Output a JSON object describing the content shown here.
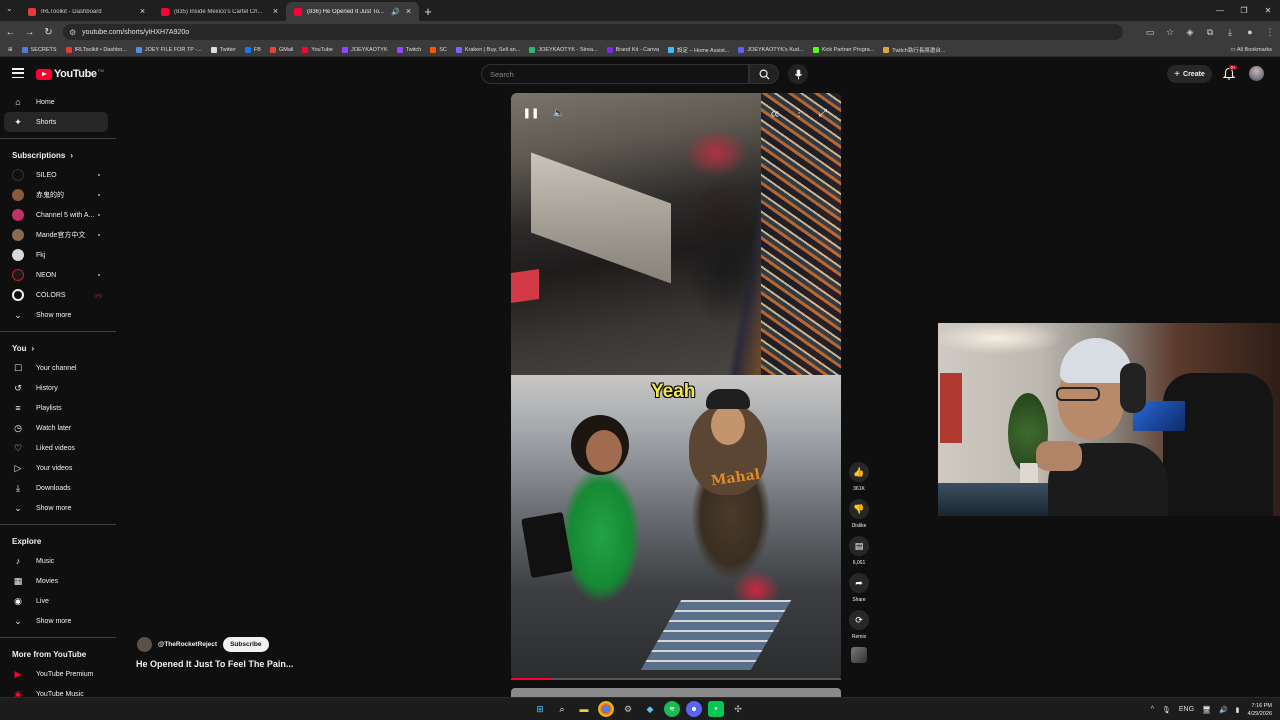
{
  "browser": {
    "tabs": [
      {
        "title": "IRLToolkit - Dashboard",
        "icon": "irltoolkit-icon",
        "active": false
      },
      {
        "title": "(835) Inside Mexico's Cartel Ch...",
        "icon": "youtube-icon",
        "active": false
      },
      {
        "title": "(836) He Opened It Just To...",
        "icon": "youtube-icon",
        "active": true
      }
    ],
    "url": "youtube.com/shorts/yiHXH7A920o",
    "bookmarks": [
      {
        "label": "SECRETS",
        "color": "#4f7bd8"
      },
      {
        "label": "IRLToolkit • Dashbo...",
        "color": "#e23b3b"
      },
      {
        "label": "JOEY FILE FOR TP -...",
        "color": "#4f8ee8"
      },
      {
        "label": "Twitter",
        "color": "#dddddd"
      },
      {
        "label": "FB",
        "color": "#1877f2"
      },
      {
        "label": "GMail",
        "color": "#ea4335"
      },
      {
        "label": "YouTube",
        "color": "#ff0033"
      },
      {
        "label": "JOEYKAOTYK",
        "color": "#9146ff"
      },
      {
        "label": "Twitch",
        "color": "#9146ff"
      },
      {
        "label": "SC",
        "color": "#ff5500"
      },
      {
        "label": "Kraken | Buy, Sell an...",
        "color": "#7b61ff"
      },
      {
        "label": "JOEYKAOTYK - Strea...",
        "color": "#2bb673"
      },
      {
        "label": "Brand Kit - Canva",
        "color": "#7d2ae8"
      },
      {
        "label": "設定 – Home Assist...",
        "color": "#41bdf5"
      },
      {
        "label": "JOEYKAOTYK's Kud...",
        "color": "#5865f2"
      },
      {
        "label": "Kick Partner Progra...",
        "color": "#53fc18"
      },
      {
        "label": "Twitch執行長將邀台...",
        "color": "#d9a441"
      }
    ],
    "all_bookmarks": "All Bookmarks"
  },
  "masthead": {
    "logo": "YouTube",
    "logo_suffix": "TW",
    "search_placeholder": "Search",
    "create_label": "Create",
    "notif_count": "9+"
  },
  "sidebar": {
    "main": [
      {
        "label": "Home",
        "icon": "home-icon",
        "glyph": "⌂"
      },
      {
        "label": "Shorts",
        "icon": "shorts-icon",
        "glyph": "✦"
      }
    ],
    "subscriptions_title": "Subscriptions",
    "subscriptions": [
      {
        "label": "SILEO",
        "color": "#111111",
        "badge": "dot"
      },
      {
        "label": "赤鬼的的",
        "color": "#8b5a3c",
        "badge": "dot"
      },
      {
        "label": "Channel 5 with A...",
        "color": "#c0306a",
        "badge": "dot"
      },
      {
        "label": "Mande官方中文",
        "color": "#8a6a50",
        "badge": "dot"
      },
      {
        "label": "Fkj",
        "color": "#d8d8d8",
        "badge": ""
      },
      {
        "label": "NEON",
        "color": "#cc1a2a",
        "badge": "dot"
      },
      {
        "label": "COLORS",
        "color": "#f4f4f4",
        "badge": "live"
      }
    ],
    "show_more": "Show more",
    "you_title": "You",
    "you": [
      {
        "label": "Your channel",
        "icon": "channel-icon",
        "glyph": "☐"
      },
      {
        "label": "History",
        "icon": "history-icon",
        "glyph": "↺"
      },
      {
        "label": "Playlists",
        "icon": "playlists-icon",
        "glyph": "≡"
      },
      {
        "label": "Watch later",
        "icon": "clock-icon",
        "glyph": "◷"
      },
      {
        "label": "Liked videos",
        "icon": "like-icon",
        "glyph": "♡"
      },
      {
        "label": "Your videos",
        "icon": "your-videos-icon",
        "glyph": "▷"
      },
      {
        "label": "Downloads",
        "icon": "download-icon",
        "glyph": "⤓"
      }
    ],
    "explore_title": "Explore",
    "explore": [
      {
        "label": "Music",
        "icon": "music-icon",
        "glyph": "♪"
      },
      {
        "label": "Movies",
        "icon": "movies-icon",
        "glyph": "▦"
      },
      {
        "label": "Live",
        "icon": "live-icon",
        "glyph": "◉"
      }
    ],
    "more_title": "More from YouTube",
    "more": [
      {
        "label": "YouTube Premium",
        "color": "#ff0033"
      },
      {
        "label": "YouTube Music",
        "color": "#ff0033"
      }
    ]
  },
  "short": {
    "caption": "Yeah",
    "channel": "@TheRocketReject",
    "subscribe": "Subscribe",
    "title": "He Opened It Just To Feel The Pain...",
    "progress": 0.12,
    "actions": [
      {
        "label": "361K",
        "icon": "thumbs-up-icon",
        "glyph": "👍"
      },
      {
        "label": "Dislike",
        "icon": "thumbs-down-icon",
        "glyph": "👎"
      },
      {
        "label": "6,061",
        "icon": "comment-icon",
        "glyph": "💬"
      },
      {
        "label": "Share",
        "icon": "share-icon",
        "glyph": "➦"
      },
      {
        "label": "Remix",
        "icon": "remix-icon",
        "glyph": "⟳"
      }
    ]
  },
  "taskbar": {
    "lang": "ENG",
    "time": "7:16 PM",
    "date": "4/29/2026"
  }
}
